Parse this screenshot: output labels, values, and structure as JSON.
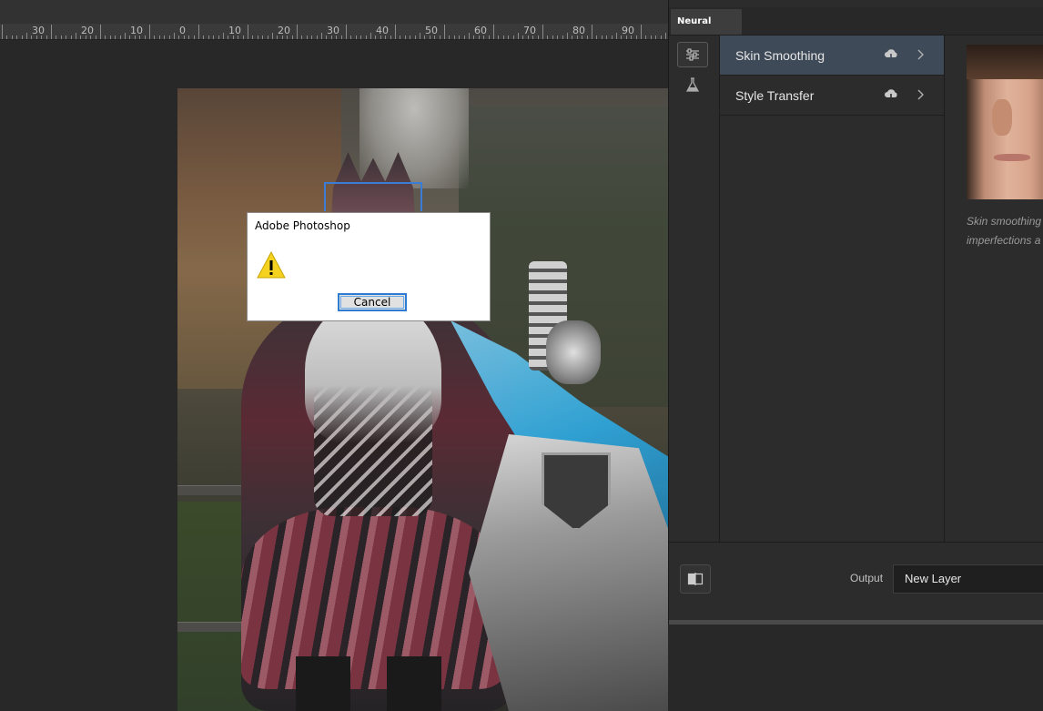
{
  "ruler": {
    "labels": [
      "30",
      "20",
      "10",
      "0",
      "10",
      "20",
      "30",
      "40",
      "50",
      "60",
      "70",
      "80",
      "90"
    ]
  },
  "dialog": {
    "title": "Adobe Photoshop",
    "icon": "warning-icon",
    "cancel_label": "Cancel"
  },
  "neural_filters": {
    "tab_label": "Neural Filters",
    "rail_icons": [
      "sliders-icon",
      "flask-icon"
    ],
    "filters": [
      {
        "label": "Skin Smoothing",
        "active": true,
        "icon": "cloud-download-icon"
      },
      {
        "label": "Style Transfer",
        "active": false,
        "icon": "cloud-download-icon"
      }
    ],
    "description_lines": [
      "Skin smoothing",
      "imperfections a"
    ],
    "output_label": "Output",
    "output_value": "New Layer",
    "compare_icon": "compare-icon"
  },
  "colors": {
    "workspace": "#282828",
    "panel": "#2c2c2c",
    "active_item": "#3f4a58",
    "dialog_button_border": "#2f7dd1",
    "warning": "#f4d21f"
  }
}
